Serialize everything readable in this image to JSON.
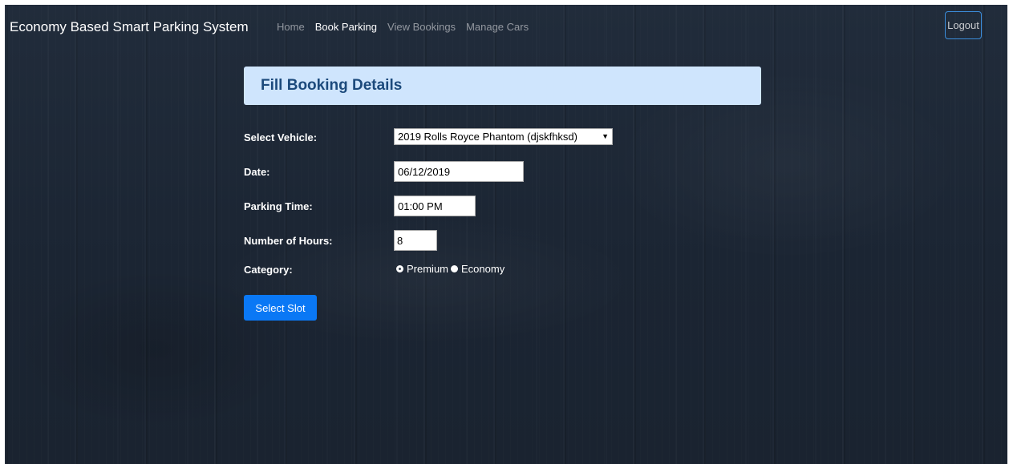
{
  "navbar": {
    "brand": "Economy Based Smart Parking System",
    "links": [
      {
        "label": "Home",
        "active": false
      },
      {
        "label": "Book Parking",
        "active": true
      },
      {
        "label": "View Bookings",
        "active": false
      },
      {
        "label": "Manage Cars",
        "active": false
      }
    ],
    "logout_label": "Logout"
  },
  "form": {
    "title": "Fill Booking Details",
    "vehicle": {
      "label": "Select Vehicle:",
      "selected": "2019 Rolls Royce Phantom (djskfhksd)"
    },
    "date": {
      "label": "Date:",
      "value": "06/12/2019"
    },
    "parking_time": {
      "label": "Parking Time:",
      "value": "01:00 PM"
    },
    "hours": {
      "label": "Number of Hours:",
      "value": "8"
    },
    "category": {
      "label": "Category:",
      "options": [
        {
          "label": "Premium",
          "checked": true
        },
        {
          "label": "Economy",
          "checked": false
        }
      ]
    },
    "submit_label": "Select Slot"
  },
  "colors": {
    "background": "#1c2532",
    "header_bg": "#cfe5fd",
    "header_text": "#1c4a7c",
    "primary_button": "#0a78f5",
    "logout_border": "#3b8ddb"
  }
}
